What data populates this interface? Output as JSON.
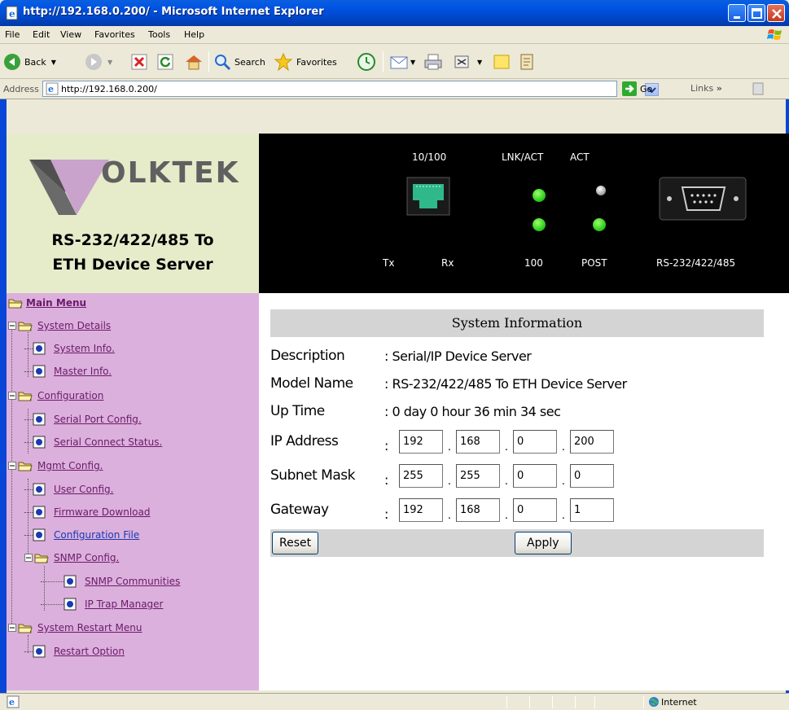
{
  "window": {
    "title": "http://192.168.0.200/ - Microsoft Internet Explorer"
  },
  "menubar": {
    "items": [
      "File",
      "Edit",
      "View",
      "Favorites",
      "Tools",
      "Help"
    ]
  },
  "toolbar": {
    "back_label": "Back",
    "search_label": "Search",
    "favorites_label": "Favorites"
  },
  "address": {
    "label": "Address",
    "url": "http://192.168.0.200/",
    "go_label": "Go",
    "links_label": "Links"
  },
  "brand": {
    "name": "OLKTEK",
    "product_line1": "RS-232/422/485 To",
    "product_line2": "ETH Device Server"
  },
  "panel": {
    "port_label": "10/100",
    "lnk_label": "LNK/ACT",
    "act_label": "ACT",
    "tx_label": "Tx",
    "rx_label": "Rx",
    "speed_label": "100",
    "post_label": "POST",
    "serial_label": "RS-232/422/485"
  },
  "tree": {
    "main_menu": "Main Menu",
    "system_details": "System Details",
    "system_info": "System Info.",
    "master_info": "Master Info.",
    "configuration": "Configuration",
    "serial_port_config": "Serial Port Config.",
    "serial_connect_status": "Serial Connect Status.",
    "mgmt_config": "Mgmt Config.",
    "user_config": "User Config.",
    "firmware_download": "Firmware Download",
    "configuration_file": "Configuration File",
    "snmp_config": "SNMP Config.",
    "snmp_communities": "SNMP Communities",
    "ip_trap_manager": "IP Trap Manager",
    "system_restart_menu": "System Restart Menu",
    "restart_option": "Restart Option"
  },
  "system_info": {
    "heading": "System Information",
    "description_label": "Description",
    "description_value": ": Serial/IP Device Server",
    "model_label": "Model Name",
    "model_value": ": RS-232/422/485 To ETH Device Server",
    "uptime_label": "Up Time",
    "uptime_value": ": 0 day 0 hour 36 min 34 sec",
    "ip_label": "IP Address",
    "ip": [
      "192",
      "168",
      "0",
      "200"
    ],
    "subnet_label": "Subnet Mask",
    "subnet": [
      "255",
      "255",
      "0",
      "0"
    ],
    "gateway_label": "Gateway",
    "gateway": [
      "192",
      "168",
      "0",
      "1"
    ],
    "colon": ":",
    "dot": ".",
    "reset_label": "Reset",
    "apply_label": "Apply"
  },
  "status": {
    "zone": "Internet"
  },
  "colors": {
    "menu_bg": "#dcb0dc",
    "logo_bg": "#e6ecca",
    "link_purple": "#6a1b6a",
    "link_blue": "#1a3ab2",
    "led_green": "#2fcf1f"
  }
}
